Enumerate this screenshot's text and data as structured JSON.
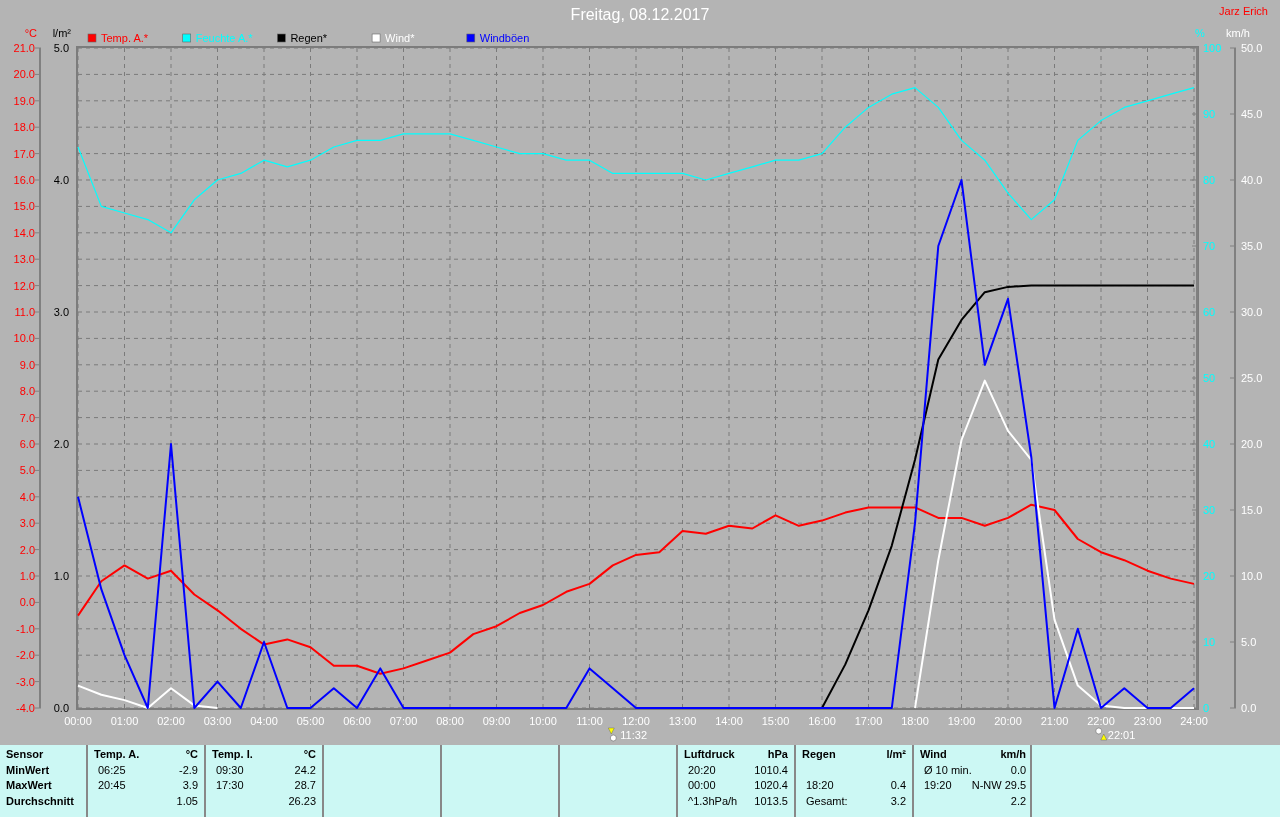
{
  "header": {
    "author": "Jarz Erich"
  },
  "charts": [
    {
      "chart_data": {
        "type": "line",
        "title": "Freitag, 08.12.2017",
        "grid": true,
        "legend": "top",
        "ylabel": "°C",
        "y2label": "l/m²",
        "x": [
          0,
          0.5,
          1,
          1.5,
          2,
          2.5,
          3,
          3.5,
          4,
          4.5,
          5,
          5.5,
          6,
          6.5,
          7,
          7.5,
          8,
          8.5,
          9,
          9.5,
          10,
          10.5,
          11,
          11.5,
          12,
          12.5,
          13,
          13.5,
          14,
          14.5,
          15,
          15.5,
          16,
          16.5,
          17,
          17.5,
          18,
          18.5,
          19,
          19.5,
          20,
          20.5,
          21,
          21.5,
          22,
          22.5,
          23,
          23.5,
          24
        ],
        "xlim": [
          0,
          24
        ],
        "xticks": [
          {
            "value": 0,
            "label": "00:00"
          },
          {
            "value": 1,
            "label": "01:00"
          },
          {
            "value": 2,
            "label": "02:00"
          },
          {
            "value": 3,
            "label": "03:00"
          },
          {
            "value": 4,
            "label": "04:00"
          },
          {
            "value": 5,
            "label": "05:00"
          },
          {
            "value": 6,
            "label": "06:00"
          },
          {
            "value": 7,
            "label": "07:00"
          },
          {
            "value": 8,
            "label": "08:00"
          },
          {
            "value": 9,
            "label": "09:00"
          },
          {
            "value": 10,
            "label": "10:00"
          },
          {
            "value": 11,
            "label": "11:00"
          },
          {
            "value": 12,
            "label": "12:00"
          },
          {
            "value": 13,
            "label": "13:00"
          },
          {
            "value": 14,
            "label": "14:00"
          },
          {
            "value": 15,
            "label": "15:00"
          },
          {
            "value": 16,
            "label": "16:00"
          },
          {
            "value": 17,
            "label": "17:00"
          },
          {
            "value": 18,
            "label": "18:00"
          },
          {
            "value": 19,
            "label": "19:00"
          },
          {
            "value": 20,
            "label": "20:00"
          },
          {
            "value": 21,
            "label": "21:00"
          },
          {
            "value": 22,
            "label": "22:00"
          },
          {
            "value": 23,
            "label": "23:00"
          },
          {
            "value": 24,
            "label": "24:00"
          }
        ],
        "ylim": [
          -4,
          21
        ],
        "yticks": [
          {
            "value": 21,
            "label": "21.0"
          },
          {
            "value": 20,
            "label": "20.0"
          },
          {
            "value": 19,
            "label": "19.0"
          },
          {
            "value": 18,
            "label": "18.0"
          },
          {
            "value": 17,
            "label": "17.0"
          },
          {
            "value": 16,
            "label": "16.0"
          },
          {
            "value": 15,
            "label": "15.0"
          },
          {
            "value": 14,
            "label": "14.0"
          },
          {
            "value": 13,
            "label": "13.0"
          },
          {
            "value": 12,
            "label": "12.0"
          },
          {
            "value": 11,
            "label": "11.0"
          },
          {
            "value": 10,
            "label": "10.0"
          },
          {
            "value": 9,
            "label": "9.0"
          },
          {
            "value": 8,
            "label": "8.0"
          },
          {
            "value": 7,
            "label": "7.0"
          },
          {
            "value": 6,
            "label": "6.0"
          },
          {
            "value": 5,
            "label": "5.0"
          },
          {
            "value": 4,
            "label": "4.0"
          },
          {
            "value": 3,
            "label": "3.0"
          },
          {
            "value": 2,
            "label": "2.0"
          },
          {
            "value": 1,
            "label": "1.0"
          },
          {
            "value": 0,
            "label": "0.0"
          },
          {
            "value": -1,
            "label": "-1.0"
          },
          {
            "value": -2,
            "label": "-2.0"
          },
          {
            "value": -3,
            "label": "-3.0"
          },
          {
            "value": -4,
            "label": "-4.0"
          }
        ],
        "y2lim": [
          0,
          5
        ],
        "y2ticks": [
          {
            "value": 5,
            "label": "5.0"
          },
          {
            "value": 4,
            "label": "4.0"
          },
          {
            "value": 3,
            "label": "3.0"
          },
          {
            "value": 2,
            "label": "2.0"
          },
          {
            "value": 1,
            "label": "1.0"
          },
          {
            "value": 0,
            "label": "0.0"
          }
        ],
        "series": [
          {
            "name": "Temp. A.*",
            "color": "#ff0000",
            "values": [
              -0.5,
              0.8,
              1.4,
              0.9,
              1.2,
              0.3,
              -0.3,
              -1.0,
              -1.6,
              -1.4,
              -1.7,
              -2.4,
              -2.4,
              -2.7,
              -2.5,
              -2.2,
              -1.9,
              -1.2,
              -0.9,
              -0.4,
              -0.1,
              0.4,
              0.7,
              1.4,
              1.8,
              1.9,
              2.7,
              2.6,
              2.9,
              2.8,
              3.3,
              2.9,
              3.1,
              3.4,
              3.6,
              3.6,
              3.6,
              3.2,
              3.2,
              2.9,
              3.2,
              3.7,
              3.5,
              2.4,
              1.9,
              1.6,
              1.2,
              0.9,
              0.7
            ]
          },
          {
            "name": "Regen*",
            "color": "#000000",
            "axis": "y2",
            "values": [
              null,
              null,
              null,
              null,
              null,
              null,
              null,
              null,
              null,
              null,
              null,
              null,
              null,
              null,
              null,
              null,
              null,
              null,
              null,
              null,
              null,
              null,
              null,
              null,
              null,
              null,
              null,
              null,
              null,
              null,
              null,
              null,
              0,
              0.33,
              0.74,
              1.23,
              1.88,
              2.64,
              2.94,
              3.15,
              3.19,
              3.2,
              3.2,
              3.2,
              3.2,
              3.2,
              3.2,
              3.2,
              3.2
            ]
          }
        ],
        "annotations": [
          "11:32",
          "22:01"
        ]
      }
    },
    {
      "chart_data": {
        "type": "line",
        "grid": false,
        "legend": "top",
        "ylabel": "%",
        "y2label": "km/h",
        "x": [
          0,
          0.5,
          1,
          1.5,
          2,
          2.5,
          3,
          3.5,
          4,
          4.5,
          5,
          5.5,
          6,
          6.5,
          7,
          7.5,
          8,
          8.5,
          9,
          9.5,
          10,
          10.5,
          11,
          11.5,
          12,
          12.5,
          13,
          13.5,
          14,
          14.5,
          15,
          15.5,
          16,
          16.5,
          17,
          17.5,
          18,
          18.5,
          19,
          19.5,
          20,
          20.5,
          21,
          21.5,
          22,
          22.5,
          23,
          23.5,
          24
        ],
        "xlim": [
          0,
          24
        ],
        "ylim": [
          0,
          100
        ],
        "yticks": [
          {
            "value": 100,
            "label": "100"
          },
          {
            "value": 90,
            "label": "90"
          },
          {
            "value": 80,
            "label": "80"
          },
          {
            "value": 70,
            "label": "70"
          },
          {
            "value": 60,
            "label": "60"
          },
          {
            "value": 50,
            "label": "50"
          },
          {
            "value": 40,
            "label": "40"
          },
          {
            "value": 30,
            "label": "30"
          },
          {
            "value": 20,
            "label": "20"
          },
          {
            "value": 10,
            "label": "10"
          },
          {
            "value": 0,
            "label": "0"
          }
        ],
        "y2lim": [
          0,
          50
        ],
        "y2ticks": [
          {
            "value": 50,
            "label": "50.0"
          },
          {
            "value": 45,
            "label": "45.0"
          },
          {
            "value": 40,
            "label": "40.0"
          },
          {
            "value": 35,
            "label": "35.0"
          },
          {
            "value": 30,
            "label": "30.0"
          },
          {
            "value": 25,
            "label": "25.0"
          },
          {
            "value": 20,
            "label": "20.0"
          },
          {
            "value": 15,
            "label": "15.0"
          },
          {
            "value": 10,
            "label": "10.0"
          },
          {
            "value": 5,
            "label": "5.0"
          },
          {
            "value": 0,
            "label": "0.0"
          }
        ],
        "series": [
          {
            "name": "Feuchte A.*",
            "color": "#00ffff",
            "values": [
              85,
              76,
              75,
              74,
              72,
              77,
              80,
              81,
              83,
              82,
              83,
              85,
              86,
              86,
              87,
              87,
              87,
              86,
              85,
              84,
              84,
              83,
              83,
              81,
              81,
              81,
              81,
              80,
              81,
              82,
              83,
              83,
              84,
              88,
              91,
              93,
              94,
              91,
              86,
              83,
              78,
              74,
              77,
              86,
              89,
              91,
              92,
              93,
              94
            ]
          },
          {
            "name": "Wind*",
            "color": "#ffffff",
            "axis": "y2",
            "values": [
              1.7,
              1.0,
              0.6,
              0,
              1.5,
              0.2,
              0,
              null,
              null,
              null,
              null,
              null,
              null,
              null,
              null,
              null,
              null,
              null,
              null,
              null,
              null,
              null,
              null,
              null,
              null,
              null,
              null,
              null,
              null,
              null,
              null,
              null,
              null,
              null,
              null,
              null,
              0,
              11.2,
              20.3,
              24.8,
              21,
              18.8,
              6.7,
              1.7,
              0.2,
              0,
              0,
              0,
              0
            ]
          },
          {
            "name": "Windböen",
            "color": "#0000ff",
            "axis": "y2",
            "values": [
              16,
              9,
              4,
              0,
              20,
              0,
              2,
              0,
              5,
              0,
              0,
              1.5,
              0,
              3,
              0,
              0,
              0,
              0,
              0,
              0,
              0,
              0,
              3,
              1.5,
              0,
              0,
              0,
              0,
              0,
              0,
              0,
              0,
              0,
              0,
              0,
              0,
              14,
              35,
              40,
              26,
              31,
              19,
              0,
              6,
              0,
              1.5,
              0,
              0,
              1.5
            ]
          }
        ]
      }
    }
  ],
  "marker_icons": [
    {
      "kind": "down"
    },
    {
      "kind": "up"
    }
  ],
  "stats": {
    "row_labels": [
      "Sensor",
      "MinWert",
      "MaxWert",
      "Durchschnitt"
    ],
    "sections": [
      {
        "title": "Temp. A.",
        "unit": "°C",
        "rows": [
          {
            "label": "06:25",
            "value": "-2.9"
          },
          {
            "label": "20:45",
            "value": "3.9"
          },
          {
            "value": "1.05"
          }
        ]
      },
      {
        "title": "Temp. I.",
        "unit": "°C",
        "rows": [
          {
            "label": "09:30",
            "value": "24.2"
          },
          {
            "label": "17:30",
            "value": "28.7"
          },
          {
            "value": "26.23"
          }
        ]
      },
      {
        "title": "Luftdruck",
        "unit": "hPa",
        "rows": [
          {
            "label": "20:20",
            "value": "1010.4"
          },
          {
            "label": "00:00",
            "value": "1020.4"
          },
          {
            "label": "^1.3hPa/h",
            "value": "1013.5"
          }
        ]
      },
      {
        "title": "Regen",
        "unit": "l/m²",
        "rows": [
          {},
          {
            "label": "18:20",
            "value": "0.4"
          },
          {
            "label": "Gesamt:",
            "value": "3.2"
          }
        ]
      },
      {
        "title": "Wind",
        "unit": "km/h",
        "rows": [
          {
            "label": "Ø 10 min.",
            "value": "0.0"
          },
          {
            "label": "19:20",
            "value": "N-NW 29.5"
          },
          {
            "value": "2.2"
          }
        ]
      }
    ]
  }
}
